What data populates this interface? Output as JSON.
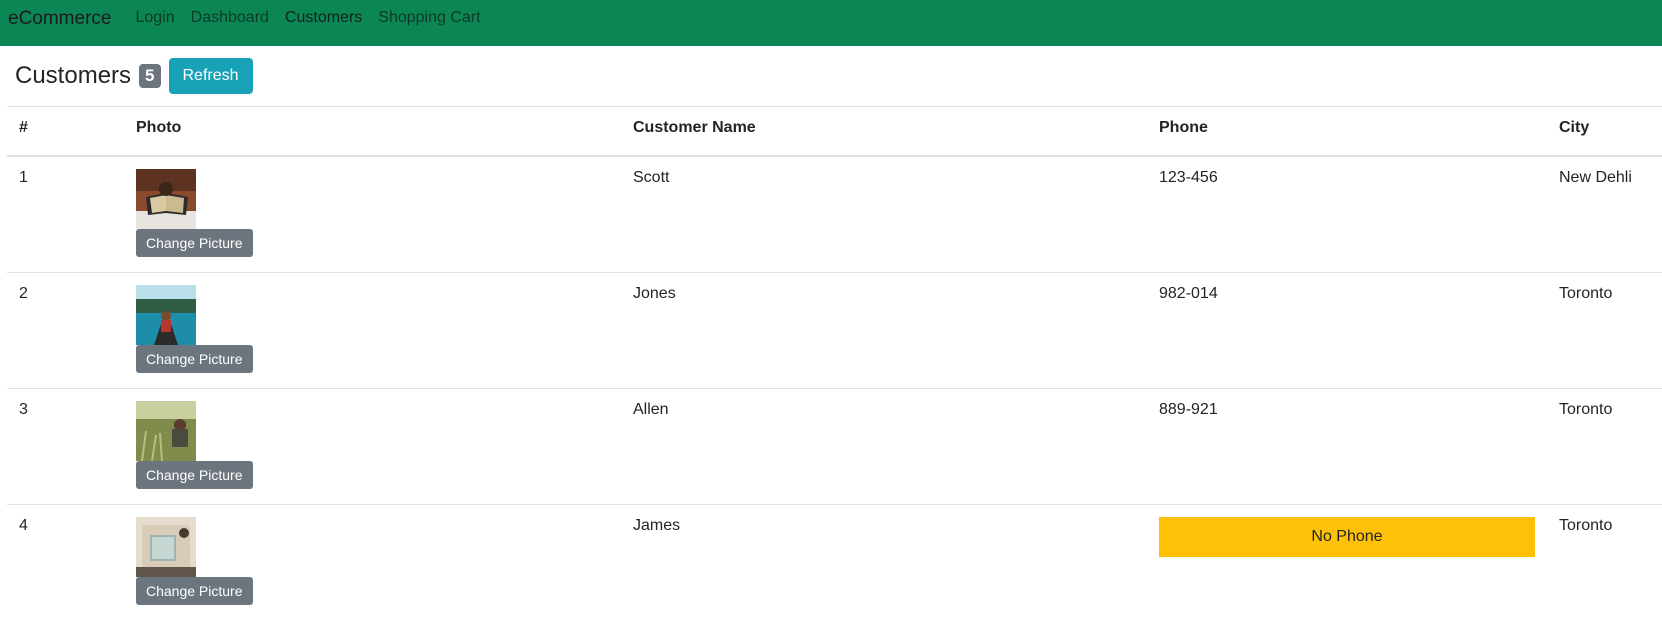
{
  "navbar": {
    "brand": "eCommerce",
    "links": [
      "Login",
      "Dashboard",
      "Customers",
      "Shopping Cart"
    ],
    "active": "Customers",
    "color": "#0d8655"
  },
  "page": {
    "title": "Customers",
    "count": "5",
    "refresh_label": "Refresh"
  },
  "table": {
    "headers": [
      "#",
      "Photo",
      "Customer Name",
      "Phone",
      "City"
    ],
    "change_picture_label": "Change Picture",
    "no_phone_label": "No Phone",
    "rows": [
      {
        "id": "1",
        "name": "Scott",
        "phone": "123-456",
        "city": "New Dehli",
        "photo": "book-reading-photo"
      },
      {
        "id": "2",
        "name": "Jones",
        "phone": "982-014",
        "city": "Toronto",
        "photo": "lake-canoe-photo"
      },
      {
        "id": "3",
        "name": "Allen",
        "phone": "889-921",
        "city": "Toronto",
        "photo": "grass-field-photo"
      },
      {
        "id": "4",
        "name": "James",
        "phone": "",
        "city": "Toronto",
        "photo": "car-window-photo"
      }
    ]
  },
  "colors": {
    "refresh": "#17a2b8",
    "badge": "#6c757d",
    "change_picture": "#6c757d",
    "no_phone": "#ffc107"
  }
}
